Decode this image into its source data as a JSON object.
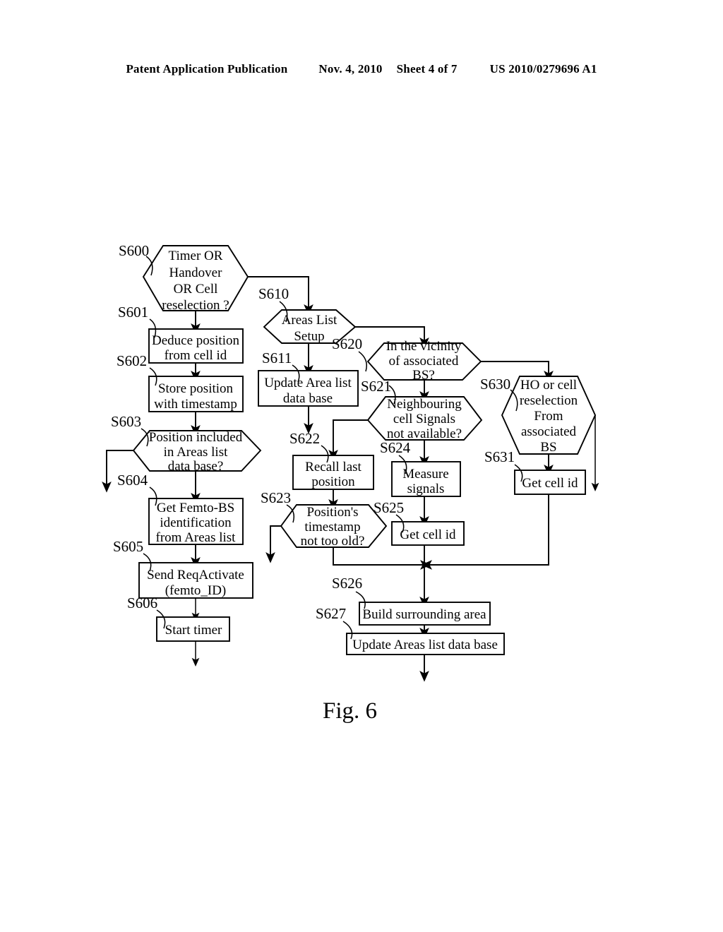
{
  "header": {
    "publication": "Patent Application Publication",
    "date": "Nov. 4, 2010",
    "sheet": "Sheet 4 of 7",
    "patent_number": "US 2010/0279696 A1"
  },
  "figure": {
    "caption": "Fig. 6"
  },
  "nodes": {
    "s600": {
      "id": "S600",
      "shape": "hexagon",
      "lines": [
        "Timer OR",
        "Handover",
        "OR Cell",
        "reselection ?"
      ]
    },
    "s601": {
      "id": "S601",
      "shape": "rect",
      "lines": [
        "Deduce position",
        "from cell id"
      ]
    },
    "s602": {
      "id": "S602",
      "shape": "rect",
      "lines": [
        "Store position",
        "with timestamp"
      ]
    },
    "s603": {
      "id": "S603",
      "shape": "hexagon",
      "lines": [
        "Position included",
        "in Areas list",
        "data base?"
      ]
    },
    "s604": {
      "id": "S604",
      "shape": "rect",
      "lines": [
        "Get Femto-BS",
        "identification",
        "from Areas list"
      ]
    },
    "s605": {
      "id": "S605",
      "shape": "rect",
      "lines": [
        "Send ReqActivate",
        "(femto_ID)"
      ]
    },
    "s606": {
      "id": "S606",
      "shape": "rect",
      "lines": [
        "Start timer"
      ]
    },
    "s610": {
      "id": "S610",
      "shape": "hexagon",
      "lines": [
        "Areas List",
        "Setup"
      ]
    },
    "s611": {
      "id": "S611",
      "shape": "rect",
      "lines": [
        "Update Area list",
        "data base"
      ]
    },
    "s620": {
      "id": "S620",
      "shape": "hexagon",
      "lines": [
        "In the vicinity",
        "of associated",
        "BS?"
      ]
    },
    "s621": {
      "id": "S621",
      "shape": "hexagon",
      "lines": [
        "Neighbouring",
        "cell Signals",
        "not available?"
      ]
    },
    "s622": {
      "id": "S622",
      "shape": "rect",
      "lines": [
        "Recall last",
        "position"
      ]
    },
    "s623": {
      "id": "S623",
      "shape": "hexagon",
      "lines": [
        "Position's",
        "timestamp",
        "not too old?"
      ]
    },
    "s624": {
      "id": "S624",
      "shape": "rect",
      "lines": [
        "Measure",
        "signals"
      ]
    },
    "s625": {
      "id": "S625",
      "shape": "rect",
      "lines": [
        "Get cell id"
      ]
    },
    "s626": {
      "id": "S626",
      "shape": "rect",
      "lines": [
        "Build surrounding area"
      ]
    },
    "s627": {
      "id": "S627",
      "shape": "rect",
      "lines": [
        "Update Areas list data base"
      ]
    },
    "s630": {
      "id": "S630",
      "shape": "hexagon",
      "lines": [
        "HO or cell",
        "reselection",
        "From",
        "associated",
        "BS"
      ]
    },
    "s631": {
      "id": "S631",
      "shape": "rect",
      "lines": [
        "Get cell id"
      ]
    }
  }
}
